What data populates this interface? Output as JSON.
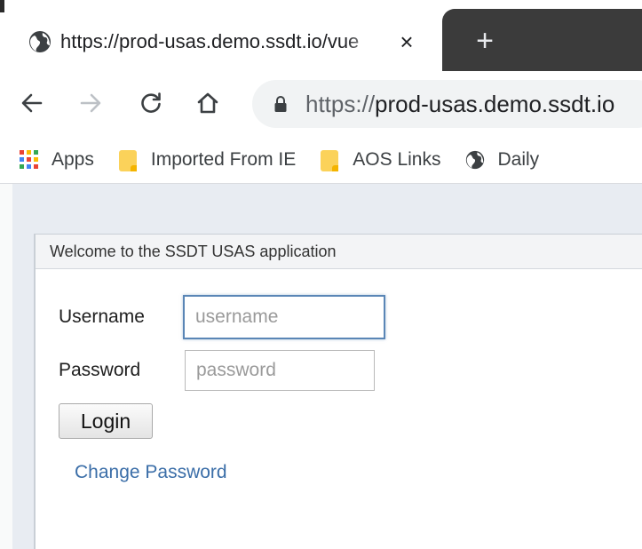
{
  "browser": {
    "tab": {
      "title": "https://prod-usas.demo.ssdt.io/vue",
      "favicon": "globe-icon",
      "close_label": "×"
    },
    "new_tab_label": "+",
    "toolbar": {
      "back_label": "←",
      "forward_label": "→",
      "reload_label": "C",
      "home_label": "⌂",
      "url_scheme": "https://",
      "url_host": "prod-usas.demo.ssdt.io"
    },
    "bookmarks": [
      {
        "label": "Apps",
        "icon": "apps-grid-icon"
      },
      {
        "label": "Imported From IE",
        "icon": "folder-icon"
      },
      {
        "label": "AOS Links",
        "icon": "folder-icon"
      },
      {
        "label": "Daily",
        "icon": "globe-icon"
      }
    ]
  },
  "page": {
    "panel_title": "Welcome to the SSDT USAS application",
    "username": {
      "label": "Username",
      "value": "",
      "placeholder": "username"
    },
    "password": {
      "label": "Password",
      "value": "",
      "placeholder": "password"
    },
    "login_label": "Login",
    "change_password_label": "Change Password"
  },
  "colors": {
    "link": "#3b6ea8",
    "focus_border": "#5a86b6",
    "folder": "#fbd25a",
    "tabstrip_dark": "#3b3b3b"
  }
}
